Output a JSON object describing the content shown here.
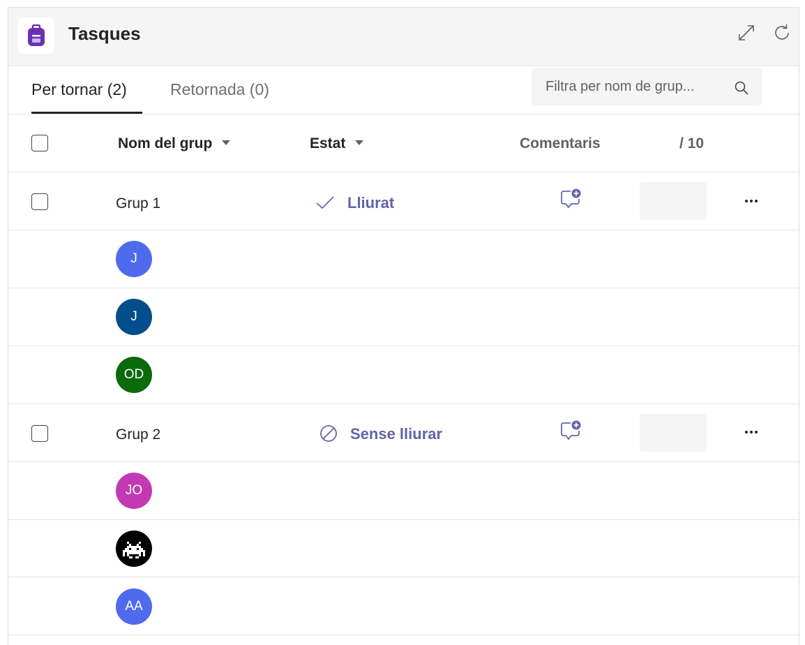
{
  "app": {
    "title": "Tasques",
    "icon": "backpack-icon",
    "accent": "#6264a7"
  },
  "header": {
    "expand_icon": "expand-icon",
    "refresh_icon": "refresh-icon"
  },
  "tabs": [
    {
      "label": "Per tornar (2)",
      "active": true
    },
    {
      "label": "Retornada (0)",
      "active": false
    }
  ],
  "search": {
    "placeholder": "Filtra per nom de grup..."
  },
  "columns": {
    "group_name": "Nom del grup",
    "status": "Estat",
    "comments": "Comentaris",
    "points": "/ 10"
  },
  "groups": [
    {
      "name": "Grup 1",
      "status": "Lliurat",
      "status_icon": "checkmark-icon",
      "members": [
        {
          "initials": "J",
          "color": "#4f6bed"
        },
        {
          "initials": "J",
          "color": "#004e8c"
        },
        {
          "initials": "OD",
          "color": "#0b6a0b"
        }
      ]
    },
    {
      "name": "Grup 2",
      "status": "Sense lliurar",
      "status_icon": "prohibited-icon",
      "members": [
        {
          "initials": "JO",
          "color": "#c239b3"
        },
        {
          "initials": "",
          "color": "#000000",
          "icon": "space-invader-icon"
        },
        {
          "initials": "AA",
          "color": "#4f6bed"
        }
      ]
    }
  ],
  "colors": {
    "accent": "#6264a7",
    "header_bg": "#f5f5f5"
  }
}
